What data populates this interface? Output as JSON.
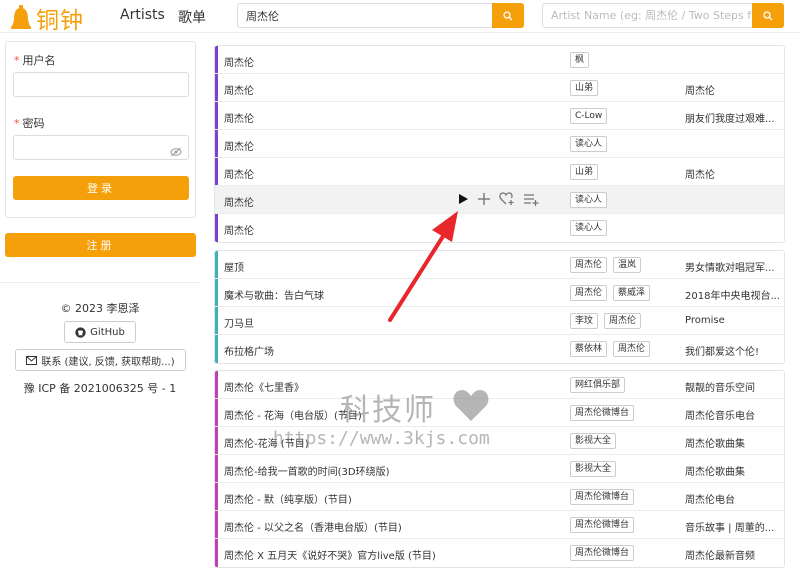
{
  "header": {
    "logo_text": "铜钟",
    "nav": [
      "Artists",
      "歌单"
    ],
    "search1_value": "周杰伦",
    "search2_placeholder": "Artist Name (eg: 周杰伦 / Two Steps fro..."
  },
  "login": {
    "username_label": "用户名",
    "password_label": "密码",
    "login_button": "登录",
    "register_button": "注册"
  },
  "footer": {
    "copyright": "© 2023 李恩泽",
    "github": "GitHub",
    "contact": "联系 (建议, 反馈, 获取帮助...)",
    "icp": "豫 ICP 备 2021006325 号 - 1"
  },
  "colors": {
    "accent": "#f5a00a",
    "purple": "#7b3fd0",
    "teal": "#3bb0bd",
    "magenta": "#c03fb8"
  },
  "list1": [
    {
      "name": "周杰伦",
      "tags": [
        "枫"
      ],
      "album": ""
    },
    {
      "name": "周杰伦",
      "tags": [
        "山弟"
      ],
      "album": "周杰伦"
    },
    {
      "name": "周杰伦",
      "tags": [
        "C-Low"
      ],
      "album": "朋友们我度过艰难..."
    },
    {
      "name": "周杰伦",
      "tags": [
        "读心人"
      ],
      "album": ""
    },
    {
      "name": "周杰伦",
      "tags": [
        "山弟"
      ],
      "album": "周杰伦"
    },
    {
      "name": "周杰伦",
      "tags": [
        "读心人"
      ],
      "album": ""
    },
    {
      "name": "周杰伦",
      "tags": [
        "读心人"
      ],
      "album": ""
    }
  ],
  "list2": [
    {
      "name": "屋顶",
      "tags": [
        "周杰伦",
        "温岚"
      ],
      "album": "男女情歌对唱冠军..."
    },
    {
      "name": "魔术与歌曲：告白气球",
      "tags": [
        "周杰伦",
        "蔡威泽"
      ],
      "album": "2018年中央电视台..."
    },
    {
      "name": "刀马旦",
      "tags": [
        "李玟",
        "周杰伦"
      ],
      "album": "Promise"
    },
    {
      "name": "布拉格广场",
      "tags": [
        "蔡依林",
        "周杰伦"
      ],
      "album": "我们都爱这个伦!"
    }
  ],
  "list3": [
    {
      "name": "周杰伦《七里香》",
      "tags": [
        "网红俱乐部"
      ],
      "album": "靓靓的音乐空间"
    },
    {
      "name": "周杰伦 - 花海（电台版）(节目)",
      "tags": [
        "周杰伦微博台"
      ],
      "album": "周杰伦音乐电台"
    },
    {
      "name": "周杰伦-花海 (节目)",
      "tags": [
        "影视大全"
      ],
      "album": "周杰伦歌曲集"
    },
    {
      "name": "周杰伦-给我一首歌的时间(3D环绕版)",
      "tags": [
        "影视大全"
      ],
      "album": "周杰伦歌曲集"
    },
    {
      "name": "周杰伦 - 默（纯享版）(节目)",
      "tags": [
        "周杰伦微博台"
      ],
      "album": "周杰伦电台"
    },
    {
      "name": "周杰伦 - 以父之名（香港电台版）(节目)",
      "tags": [
        "周杰伦微博台"
      ],
      "album": "音乐故事 | 周董的..."
    },
    {
      "name": "周杰伦 X 五月天《说好不哭》官方live版 (节目)",
      "tags": [
        "周杰伦微博台"
      ],
      "album": "周杰伦最新音频"
    }
  ],
  "watermark": {
    "text": "科技师",
    "url": "https://www.3kjs.com"
  }
}
